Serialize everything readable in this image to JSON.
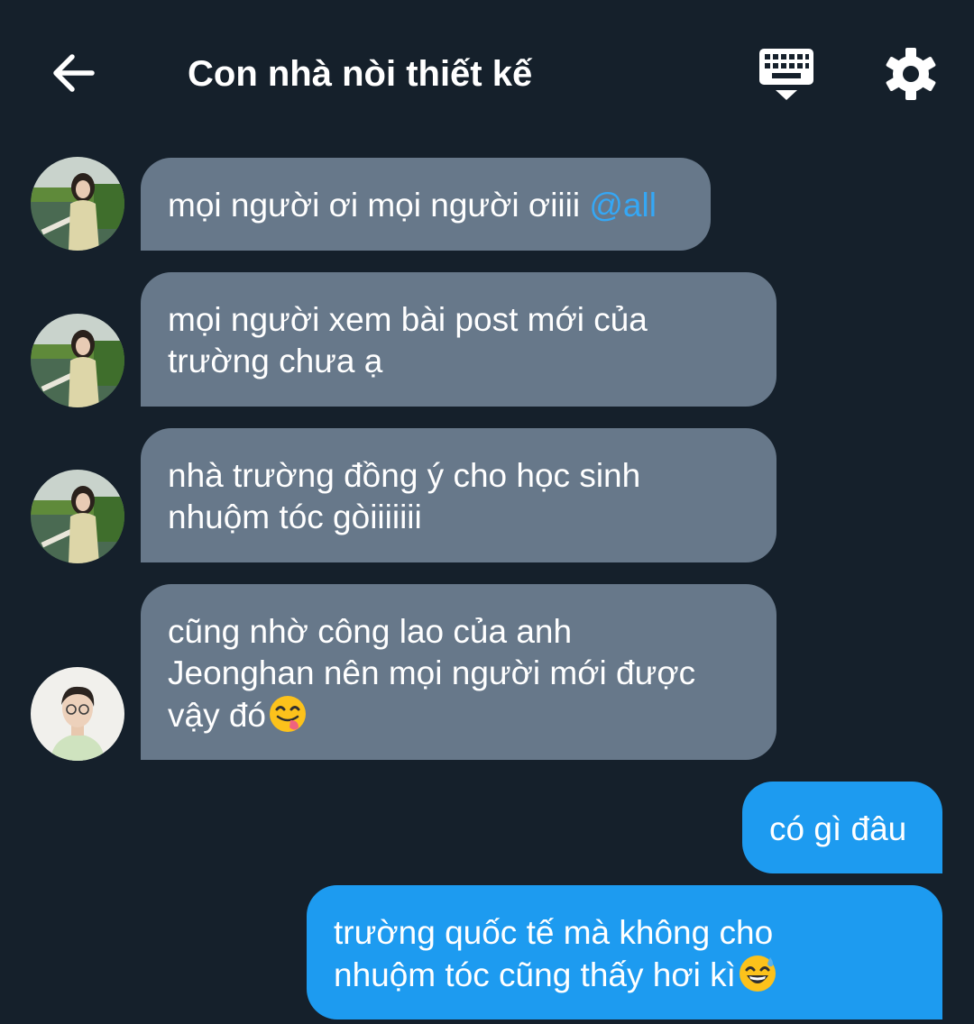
{
  "header": {
    "title": "Con nhà nòi thiết kế",
    "back_icon": "arrow-left-icon",
    "keyboard_icon": "keyboard-hide-icon",
    "settings_icon": "gear-icon"
  },
  "colors": {
    "background": "#15202b",
    "incoming_bubble": "#67788a",
    "outgoing_bubble": "#1d9bf0",
    "mention": "#35a7f5"
  },
  "messages": [
    {
      "direction": "incoming",
      "avatar": "avatar-girl",
      "text": "mọi người ơi mọi người ơiiii ",
      "mention": "@all"
    },
    {
      "direction": "incoming",
      "avatar": "avatar-girl",
      "line1": "mọi người xem bài post mới của",
      "line2": "trường chưa ạ"
    },
    {
      "direction": "incoming",
      "avatar": "avatar-girl",
      "line1": "nhà trường đồng ý cho học sinh",
      "line2": "nhuộm tóc gòiiiiiii"
    },
    {
      "direction": "incoming",
      "avatar": "avatar-boy",
      "line1": "cũng nhờ công lao của anh",
      "line2": "Jeonghan nên mọi người mới được",
      "line3": "vậy đó",
      "emoji": "face-savoring-food-emoji"
    },
    {
      "direction": "outgoing",
      "text": "có gì đâu"
    },
    {
      "direction": "outgoing",
      "line1": "trường quốc tế mà không cho",
      "line2": "nhuộm tóc cũng thấy hơi kì",
      "emoji": "grinning-face-with-sweat-emoji"
    }
  ]
}
